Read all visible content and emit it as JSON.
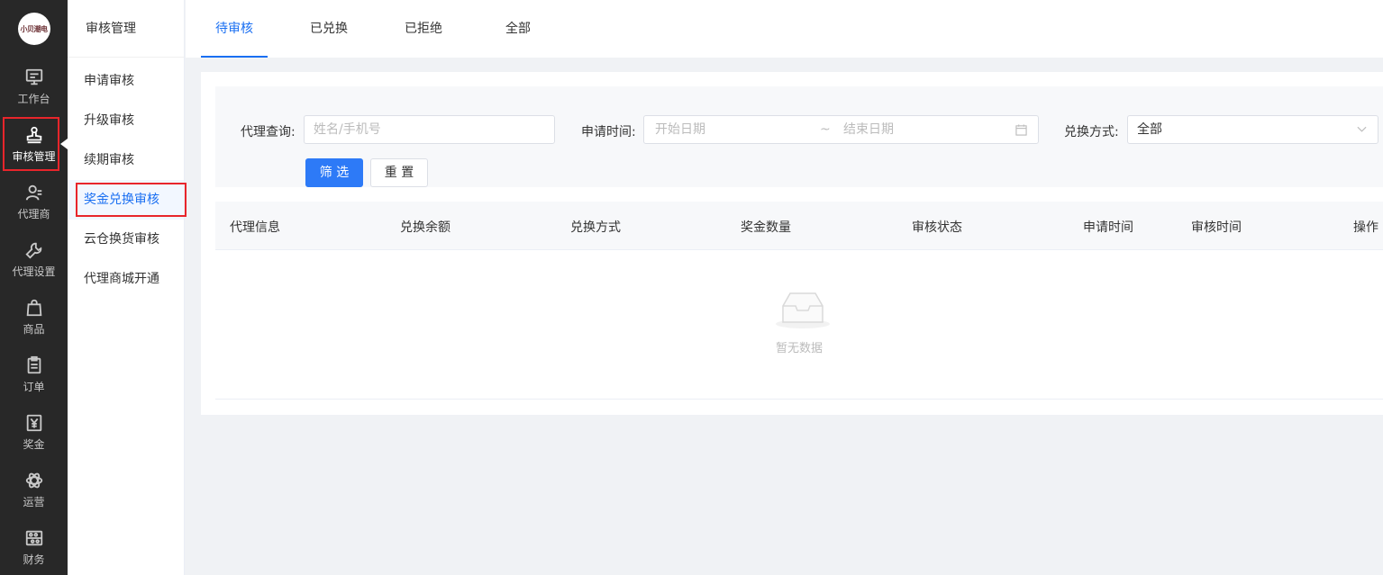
{
  "logo": {
    "text": "小贝潮电"
  },
  "rail": {
    "items": [
      {
        "label": "工作台",
        "icon": "monitor-icon"
      },
      {
        "label": "审核管理",
        "icon": "stamp-icon"
      },
      {
        "label": "代理商",
        "icon": "user-icon"
      },
      {
        "label": "代理设置",
        "icon": "wrench-icon"
      },
      {
        "label": "商品",
        "icon": "bag-icon"
      },
      {
        "label": "订单",
        "icon": "clipboard-icon"
      },
      {
        "label": "奖金",
        "icon": "yen-icon"
      },
      {
        "label": "运营",
        "icon": "atom-icon"
      },
      {
        "label": "财务",
        "icon": "abacus-icon"
      }
    ]
  },
  "subnav": {
    "title": "审核管理",
    "items": [
      {
        "label": "申请审核"
      },
      {
        "label": "升级审核"
      },
      {
        "label": "续期审核"
      },
      {
        "label": "奖金兑换审核"
      },
      {
        "label": "云仓换货审核"
      },
      {
        "label": "代理商城开通"
      }
    ]
  },
  "tabs": [
    {
      "label": "待审核"
    },
    {
      "label": "已兑换"
    },
    {
      "label": "已拒绝"
    },
    {
      "label": "全部"
    }
  ],
  "filter": {
    "agent_label": "代理查询:",
    "agent_placeholder": "姓名/手机号",
    "time_label": "申请时间:",
    "start_placeholder": "开始日期",
    "range_sep": "~",
    "end_placeholder": "结束日期",
    "method_label": "兑换方式:",
    "method_value": "全部",
    "filter_btn": "筛 选",
    "reset_btn": "重 置"
  },
  "table": {
    "columns": [
      "代理信息",
      "兑换余额",
      "兑换方式",
      "奖金数量",
      "审核状态",
      "申请时间",
      "审核时间",
      "操作"
    ],
    "empty_text": "暂无数据"
  },
  "colors": {
    "accent": "#1a6ff2",
    "highlight": "#e8252b",
    "rail_bg": "#282828"
  }
}
